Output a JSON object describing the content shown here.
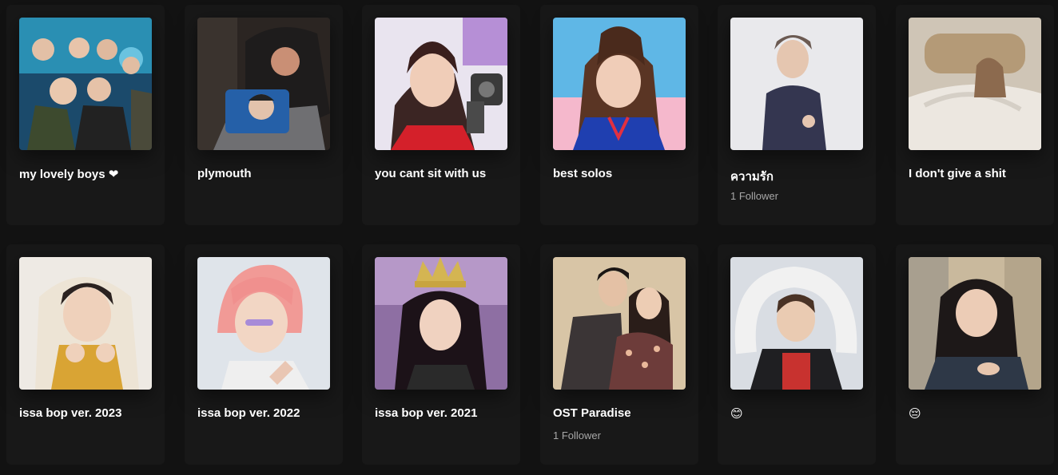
{
  "playlists": [
    {
      "title": "my lovely boys ❤",
      "subtitle": "",
      "image": "group-photo-boys"
    },
    {
      "title": "plymouth",
      "subtitle": "",
      "image": "man-in-chair-with-pillow"
    },
    {
      "title": "you cant sit with us",
      "subtitle": "",
      "image": "girl-with-toy-gun"
    },
    {
      "title": "best solos",
      "subtitle": "",
      "image": "girl-ponytail-blue-jersey"
    },
    {
      "title": "ความรัก",
      "subtitle": "1 Follower",
      "image": "man-navy-hoodie"
    },
    {
      "title": "I don't give a shit",
      "subtitle": "",
      "image": "woman-in-bed"
    },
    {
      "title": "issa bop ver. 2023",
      "subtitle": "",
      "image": "boy-white-hoodie"
    },
    {
      "title": "issa bop ver. 2022",
      "subtitle": "",
      "image": "boy-pink-hair"
    },
    {
      "title": "issa bop ver. 2021",
      "subtitle": "",
      "image": "woman-with-crown"
    },
    {
      "title": "OST Paradise",
      "subtitle": "1 Follower",
      "image": "couple-embrace"
    },
    {
      "title": "😊",
      "subtitle": "",
      "image": "boy-heart-arms"
    },
    {
      "title": "😔",
      "subtitle": "",
      "image": "crying-woman"
    }
  ]
}
